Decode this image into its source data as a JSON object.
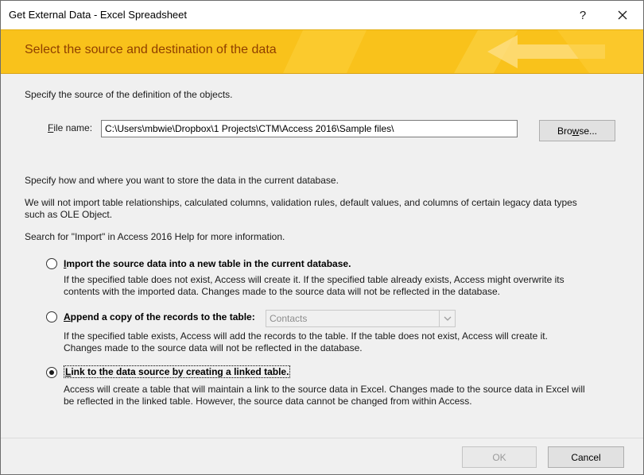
{
  "window": {
    "title": "Get External Data - Excel Spreadsheet",
    "help": "?"
  },
  "banner": {
    "heading": "Select the source and destination of the data"
  },
  "source": {
    "instruction": "Specify the source of the definition of the objects.",
    "file_label_hot": "F",
    "file_label_rest": "ile name:",
    "file_value": "C:\\Users\\mbwie\\Dropbox\\1 Projects\\CTM\\Access 2016\\Sample files\\",
    "browse_hot": "w",
    "browse_pre": "Bro",
    "browse_post": "se..."
  },
  "storage": {
    "instruction": "Specify how and where you want to store the data in the current database.",
    "note_line1": "We will not import table relationships, calculated columns, validation rules, default values, and columns of certain legacy data types",
    "note_line2": "such as OLE Object.",
    "help_hint": "Search for \"Import\" in Access 2016 Help for more information."
  },
  "options": {
    "import": {
      "hot": "I",
      "label": "mport the source data into a new table in the current database.",
      "desc_line1": "If the specified table does not exist, Access will create it. If the specified table already exists, Access might overwrite its",
      "desc_line2": "contents with the imported data. Changes made to the source data will not be reflected in the database.",
      "selected": false
    },
    "append": {
      "hot": "A",
      "label": "ppend a copy of the records to the table:",
      "table_value": "Contacts",
      "desc_line1": "If the specified table exists, Access will add the records to the table. If the table does not exist, Access will create it.",
      "desc_line2": "Changes made to the source data will not be reflected in the database.",
      "selected": false
    },
    "link": {
      "hot": "L",
      "label": "ink to the data source by creating a linked table.",
      "desc_line1": "Access will create a table that will maintain a link to the source data in Excel. Changes made to the source data in Excel will",
      "desc_line2": "be reflected in the linked table. However, the source data cannot be changed from within Access.",
      "selected": true
    }
  },
  "footer": {
    "ok": "OK",
    "cancel": "Cancel"
  },
  "colors": {
    "banner": "#f9c21b",
    "banner_text": "#8f3f00",
    "dialog_bg": "#f0f0f0"
  }
}
